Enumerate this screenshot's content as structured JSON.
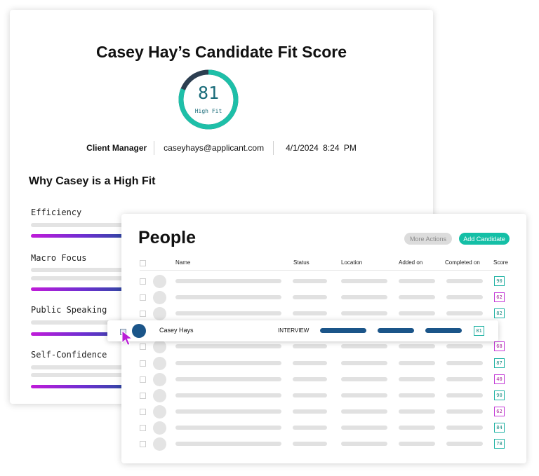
{
  "fit_card": {
    "title": "Casey Hay’s Candidate Fit Score",
    "score": {
      "value": "81",
      "label": "High Fit",
      "fraction": 0.81,
      "ring_color": "#1ebfa8",
      "remainder_color": "#2c3e50"
    },
    "meta": {
      "role": "Client Manager",
      "email": "caseyhays@applicant.com",
      "date": "4/1/2024 8:24 PM"
    },
    "why_title": "Why Casey is a High Fit",
    "traits": [
      {
        "name": "Efficiency"
      },
      {
        "name": "Macro Focus"
      },
      {
        "name": "Public Speaking"
      },
      {
        "name": "Self-Confidence"
      }
    ]
  },
  "people_card": {
    "title": "People",
    "more_actions_label": "More Actions",
    "add_candidate_label": "Add Candidate",
    "columns": {
      "name": "Name",
      "status": "Status",
      "location": "Location",
      "added_on": "Added on",
      "completed_on": "Completed on",
      "score": "Score"
    },
    "rows": [
      {
        "score": "90",
        "score_color": "teal"
      },
      {
        "score": "62",
        "score_color": "magenta"
      },
      {
        "score": "82",
        "score_color": "teal"
      },
      {
        "score": "68",
        "score_color": "magenta"
      },
      {
        "score": "87",
        "score_color": "teal"
      },
      {
        "score": "40",
        "score_color": "magenta"
      },
      {
        "score": "90",
        "score_color": "teal"
      },
      {
        "score": "62",
        "score_color": "magenta"
      },
      {
        "score": "84",
        "score_color": "teal"
      },
      {
        "score": "78",
        "score_color": "teal"
      }
    ],
    "highlighted_row": {
      "name": "Casey Hays",
      "status": "INTERVIEW",
      "score": "81",
      "selected": true
    },
    "colors": {
      "accent": "#14bfa6",
      "navy": "#1b5589",
      "magenta": "#c43ad8",
      "cursor": "#b91fd6"
    }
  },
  "icons": {
    "cursor": "pointer-cursor-icon",
    "score_ring": "score-ring-icon"
  }
}
